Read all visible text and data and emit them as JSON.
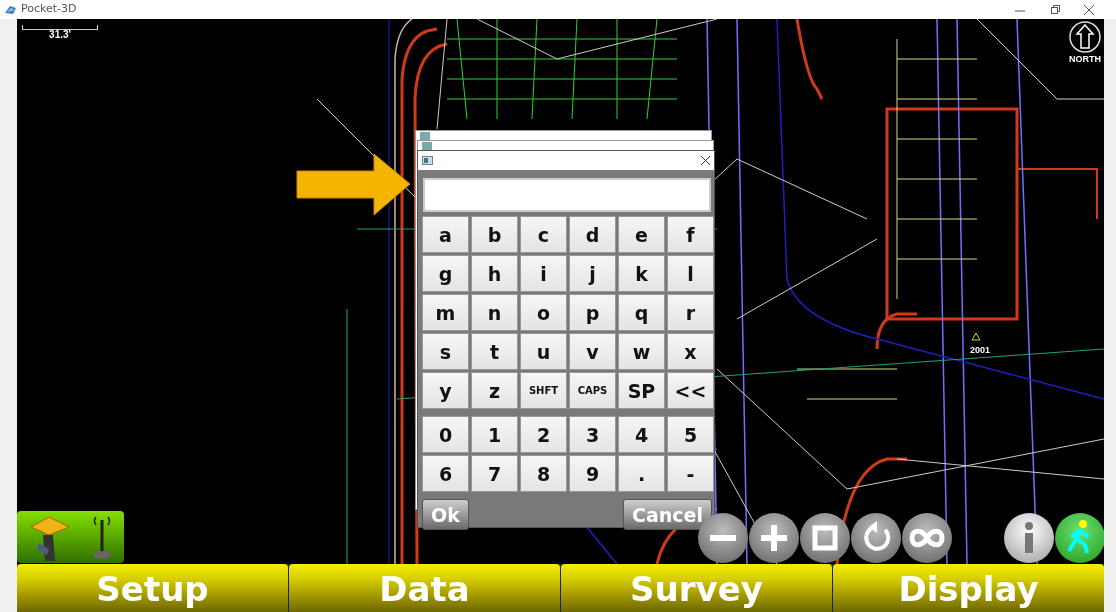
{
  "window": {
    "title": "Pocket-3D"
  },
  "map": {
    "scale_label": "31.3'",
    "north_label": "NORTH",
    "point_label": "2001"
  },
  "keypad": {
    "letter_rows": [
      [
        "a",
        "b",
        "c",
        "d",
        "e",
        "f"
      ],
      [
        "g",
        "h",
        "i",
        "j",
        "k",
        "l"
      ],
      [
        "m",
        "n",
        "o",
        "p",
        "q",
        "r"
      ],
      [
        "s",
        "t",
        "u",
        "v",
        "w",
        "x"
      ],
      [
        "y",
        "z",
        "SHFT",
        "CAPS",
        "SP",
        "<<"
      ]
    ],
    "number_rows": [
      [
        "0",
        "1",
        "2",
        "3",
        "4",
        "5"
      ],
      [
        "6",
        "7",
        "8",
        "9",
        ".",
        "-"
      ]
    ],
    "buttons": [
      "Ok",
      "Cancel"
    ]
  },
  "menu": [
    {
      "label": "Setup"
    },
    {
      "label": "Data"
    },
    {
      "label": "Survey"
    },
    {
      "label": "Display"
    }
  ]
}
